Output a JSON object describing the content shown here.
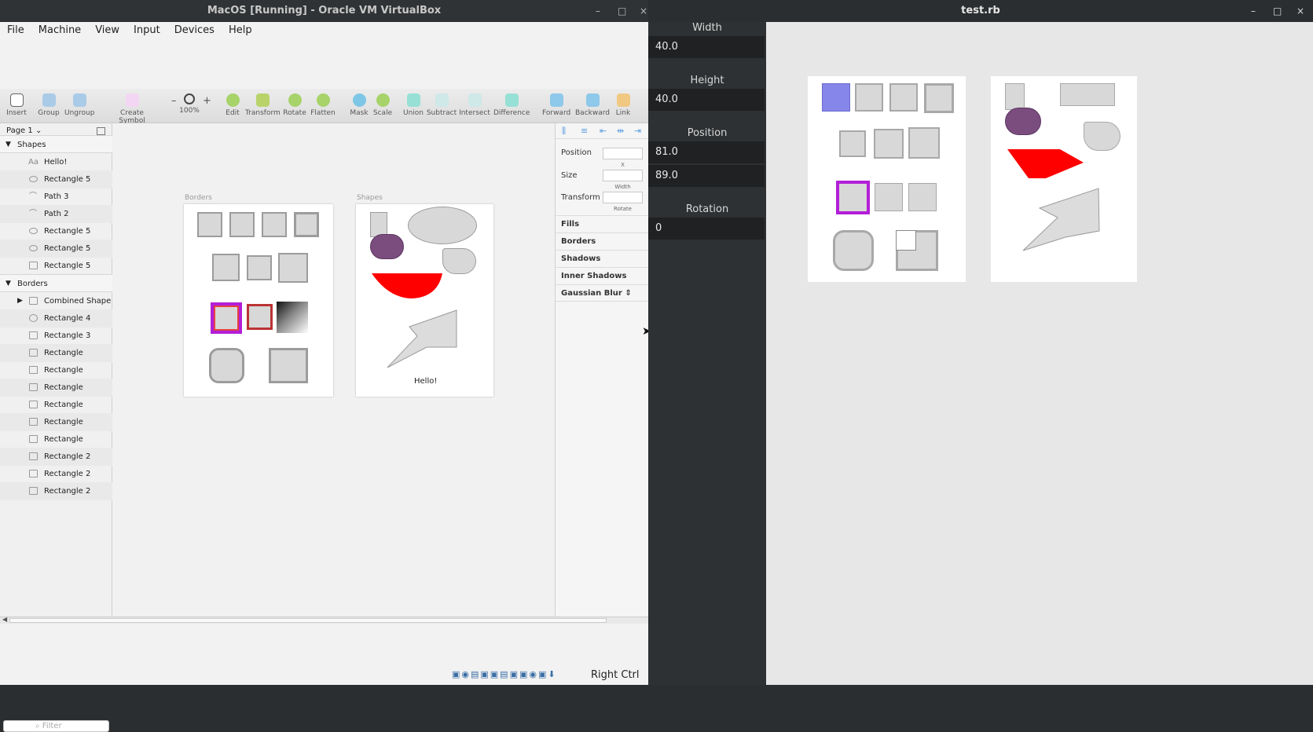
{
  "vbox_window": {
    "title": "MacOS [Running] - Oracle VM VirtualBox",
    "min": "–",
    "max": "□",
    "close": "×"
  },
  "menu": [
    "File",
    "Machine",
    "View",
    "Input",
    "Devices",
    "Help"
  ],
  "toolbar": {
    "insert": "Insert",
    "group": "Group",
    "ungroup": "Ungroup",
    "create_symbol": "Create Symbol",
    "zoom_minus": "–",
    "zoom_plus": "+",
    "zoom_level": "100%",
    "edit": "Edit",
    "transform": "Transform",
    "rotate": "Rotate",
    "flatten": "Flatten",
    "mask": "Mask",
    "scale": "Scale",
    "union": "Union",
    "subtract": "Subtract",
    "intersect": "Intersect",
    "difference": "Difference",
    "forward": "Forward",
    "backward": "Backward",
    "link": "Link"
  },
  "sidebar": {
    "page": "Page 1",
    "groups": [
      {
        "name": "Shapes",
        "items": [
          "Hello!",
          "Rectangle 5",
          "Path 3",
          "Path 2",
          "Rectangle 5",
          "Rectangle 5",
          "Rectangle 5"
        ]
      },
      {
        "name": "Borders",
        "items": [
          "Combined Shape",
          "Rectangle 4",
          "Rectangle 3",
          "Rectangle",
          "Rectangle",
          "Rectangle",
          "Rectangle",
          "Rectangle",
          "Rectangle",
          "Rectangle 2",
          "Rectangle 2",
          "Rectangle 2"
        ]
      }
    ],
    "filter_placeholder": "Filter"
  },
  "canvas": {
    "board1": "Borders",
    "board2": "Shapes",
    "hello": "Hello!"
  },
  "inspector": {
    "position": "Position",
    "x_label": "X",
    "size": "Size",
    "width_label": "Width",
    "transform": "Transform",
    "rotate_label": "Rotate",
    "sections": [
      "Fills",
      "Borders",
      "Shadows",
      "Inner Shadows",
      "Gaussian Blur"
    ]
  },
  "status": {
    "host_key": "Right Ctrl"
  },
  "test_window": {
    "title": "test.rb"
  },
  "props": {
    "width_label": "Width",
    "width_value": "40.0",
    "height_label": "Height",
    "height_value": "40.0",
    "position_label": "Position",
    "pos_x": "81.0",
    "pos_y": "89.0",
    "rotation_label": "Rotation",
    "rotation_value": "0"
  },
  "colors": {
    "purple_border": "#b21fd6",
    "plum": "#7b4d7f",
    "red": "#ff0000",
    "blue_fill": "#8686ea"
  }
}
